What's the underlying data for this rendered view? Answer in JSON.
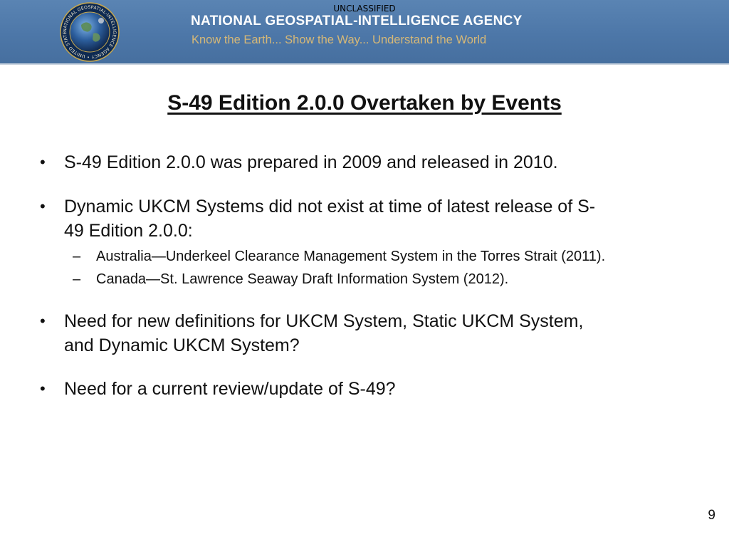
{
  "header": {
    "classification": "UNCLASSIFIED",
    "agency_name": "NATIONAL GEOSPATIAL-INTELLIGENCE AGENCY",
    "motto": "Know the Earth... Show the Way... Understand the World",
    "seal_icon": "nga-seal-icon",
    "seal_ring_text": "NATIONAL GEOSPATIAL-INTELLIGENCE AGENCY • UNITED STATES OF AMERICA •",
    "colors": {
      "banner": "#4d77a8",
      "motto": "#d6b877",
      "agency_name": "#ffffff"
    }
  },
  "slide": {
    "title": "S-49 Edition 2.0.0 Overtaken by Events",
    "bullets": [
      {
        "line1": "S-49 Edition 2.0.0 was prepared in 2009 and released in 2010."
      },
      {
        "line1": "Dynamic UKCM Systems did not exist at time of latest release of S-",
        "line2": "49 Edition 2.0.0:",
        "subitems": [
          "Australia—Underkeel Clearance Management System in the Torres Strait (2011).",
          "Canada—St. Lawrence Seaway Draft Information System (2012)."
        ]
      },
      {
        "line1": "Need for new definitions for UKCM System, Static UKCM System,",
        "line2": "and Dynamic UKCM System?"
      },
      {
        "line1": "Need for a current review/update of S-49?"
      }
    ],
    "page_number": "9"
  }
}
